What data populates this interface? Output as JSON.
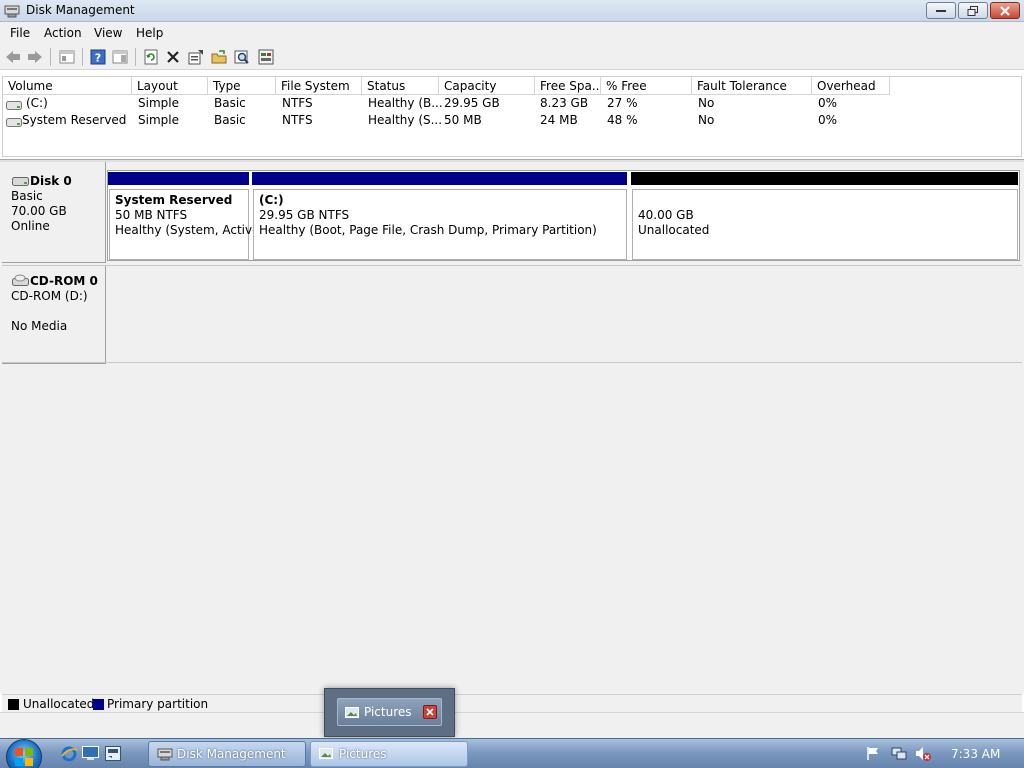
{
  "window": {
    "title": "Disk Management"
  },
  "menu": [
    "File",
    "Action",
    "View",
    "Help"
  ],
  "toolbar_icons": [
    "back-icon",
    "forward-icon",
    "console-tree-icon",
    "help-icon",
    "properties-pane-icon",
    "refresh-icon",
    "delete-icon",
    "properties-icon",
    "open-icon",
    "find-icon",
    "action-icon"
  ],
  "volumes": {
    "columns": [
      "Volume",
      "Layout",
      "Type",
      "File System",
      "Status",
      "Capacity",
      "Free Spa...",
      "% Free",
      "Fault Tolerance",
      "Overhead"
    ],
    "rows": [
      [
        "(C:)",
        "Simple",
        "Basic",
        "NTFS",
        "Healthy (B...",
        "29.95 GB",
        "8.23 GB",
        "27 %",
        "No",
        "0%"
      ],
      [
        "System Reserved",
        "Simple",
        "Basic",
        "NTFS",
        "Healthy (S...",
        "50 MB",
        "24 MB",
        "48 %",
        "No",
        "0%"
      ]
    ]
  },
  "disks": [
    {
      "name": "Disk 0",
      "type": "Basic",
      "size": "70.00 GB",
      "state": "Online",
      "partitions": [
        {
          "name": "System Reserved",
          "size": "50 MB NTFS",
          "status": "Healthy (System, Active,",
          "bar_color": "#00008b"
        },
        {
          "name": "(C:)",
          "size": "29.95 GB NTFS",
          "status": "Healthy (Boot, Page File, Crash Dump, Primary Partition)",
          "bar_color": "#00008b"
        },
        {
          "name": "",
          "size": "40.00 GB",
          "status": "Unallocated",
          "bar_color": "#000000"
        }
      ]
    },
    {
      "name": "CD-ROM 0",
      "type": "CD-ROM (D:)",
      "media": "No Media"
    }
  ],
  "legend": [
    {
      "label": "Unallocated",
      "color": "#000000"
    },
    {
      "label": "Primary partition",
      "color": "#00008b"
    }
  ],
  "thumbnail": {
    "label": "Pictures"
  },
  "taskbar": {
    "buttons": [
      {
        "label": "Disk Management"
      },
      {
        "label": "Pictures"
      }
    ],
    "clock": "7:33 AM"
  }
}
